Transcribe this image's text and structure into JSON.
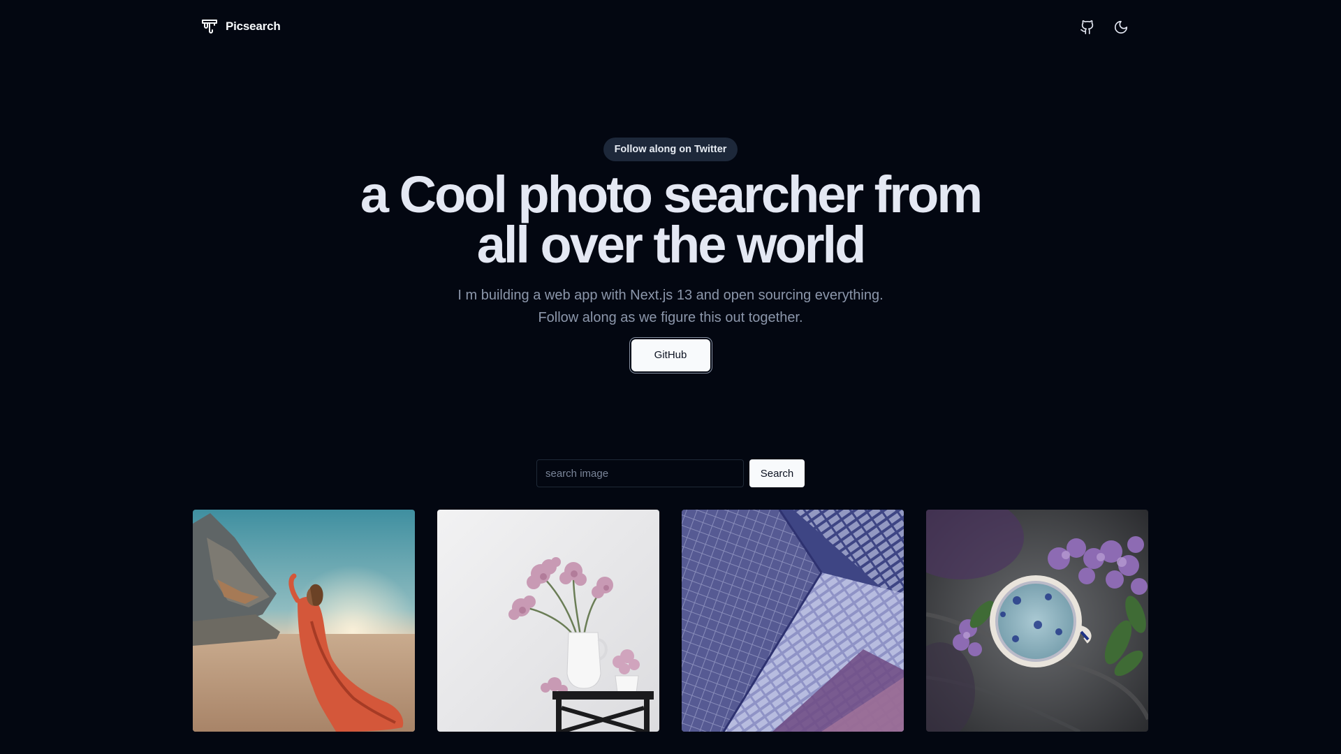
{
  "header": {
    "brand": "Picsearch",
    "icons": [
      "github-icon",
      "moon-icon"
    ]
  },
  "hero": {
    "badge": "Follow along on Twitter",
    "headline_line1": "a Cool photo searcher from",
    "headline_line2": "all over the world",
    "subtitle_line1": "I m building a web app with Next.js 13 and open sourcing everything.",
    "subtitle_line2": "Follow along as we figure this out together.",
    "cta_label": "GitHub"
  },
  "search": {
    "placeholder": "search image",
    "value": "",
    "button_label": "Search"
  },
  "gallery": {
    "photos": [
      {
        "subject": "woman in red dress in desert beside wreck"
      },
      {
        "subject": "pink flowers in white vase on stool"
      },
      {
        "subject": "glass building facade"
      },
      {
        "subject": "teacup with lilac flowers"
      }
    ]
  },
  "colors": {
    "background": "#030711",
    "foreground": "#e4e8f3",
    "muted": "#8c97ab",
    "badge_bg": "#1d283a",
    "button_bg": "#f8fafc"
  }
}
